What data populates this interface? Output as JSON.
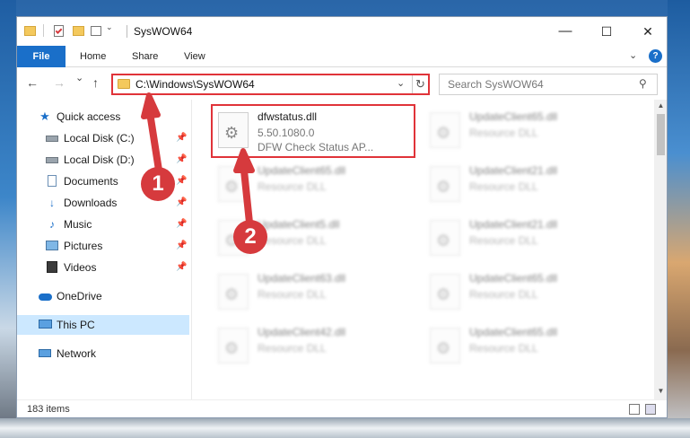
{
  "window": {
    "title": "SysWOW64"
  },
  "window_buttons": {
    "minimize": "—",
    "maximize": "☐",
    "close": "✕"
  },
  "ribbon": {
    "tabs": [
      "File",
      "Home",
      "Share",
      "View"
    ],
    "expand_glyph": "⌄",
    "help_glyph": "?"
  },
  "navigation": {
    "back_glyph": "←",
    "forward_glyph": "→",
    "recent_glyph": "⌄",
    "up_glyph": "↑",
    "address": "C:\\Windows\\SysWOW64",
    "address_dropdown_glyph": "⌄",
    "refresh_glyph": "↻",
    "search_placeholder": "Search SysWOW64",
    "search_glyph": "⚲"
  },
  "sidebar": {
    "items": [
      {
        "label": "Quick access",
        "icon": "star-icon",
        "pinned": false
      },
      {
        "label": "Local Disk (C:)",
        "icon": "drive-icon",
        "pinned": true
      },
      {
        "label": "Local Disk (D:)",
        "icon": "drive-icon",
        "pinned": true
      },
      {
        "label": "Documents",
        "icon": "documents-icon",
        "pinned": true
      },
      {
        "label": "Downloads",
        "icon": "download-icon",
        "pinned": true
      },
      {
        "label": "Music",
        "icon": "music-icon",
        "pinned": true
      },
      {
        "label": "Pictures",
        "icon": "pictures-icon",
        "pinned": true
      },
      {
        "label": "Videos",
        "icon": "videos-icon",
        "pinned": true
      },
      {
        "label": "OneDrive",
        "icon": "cloud-icon",
        "pinned": false
      },
      {
        "label": "This PC",
        "icon": "computer-icon",
        "pinned": false,
        "selected": true
      },
      {
        "label": "Network",
        "icon": "network-icon",
        "pinned": false
      }
    ],
    "pin_glyph": "📌"
  },
  "files": [
    {
      "name": "dfwstatus.dll",
      "version": "5.50.1080.0",
      "description": "DFW Check Status AP...",
      "highlighted": true
    },
    {
      "name": "UpdateClient65.dll",
      "description": "Resource DLL"
    },
    {
      "name": "UpdateClient65.dll",
      "description": "Resource DLL"
    },
    {
      "name": "UpdateClient21.dll",
      "description": "Resource DLL"
    },
    {
      "name": "UpdateClient5.dll",
      "description": "Resource DLL"
    },
    {
      "name": "UpdateClient21.dll",
      "description": "Resource DLL"
    },
    {
      "name": "UpdateClient63.dll",
      "description": "Resource DLL"
    },
    {
      "name": "UpdateClient65.dll",
      "description": "Resource DLL"
    },
    {
      "name": "UpdateClient42.dll",
      "description": "Resource DLL"
    },
    {
      "name": "UpdateClient65.dll",
      "description": "Resource DLL"
    }
  ],
  "status": {
    "item_count": "183 items"
  },
  "annotations": {
    "step1": "1",
    "step2": "2"
  },
  "colors": {
    "accent": "#1a6fc9",
    "highlight_border": "#e03339",
    "callout": "#d63a3d",
    "selection": "#cce8ff"
  }
}
